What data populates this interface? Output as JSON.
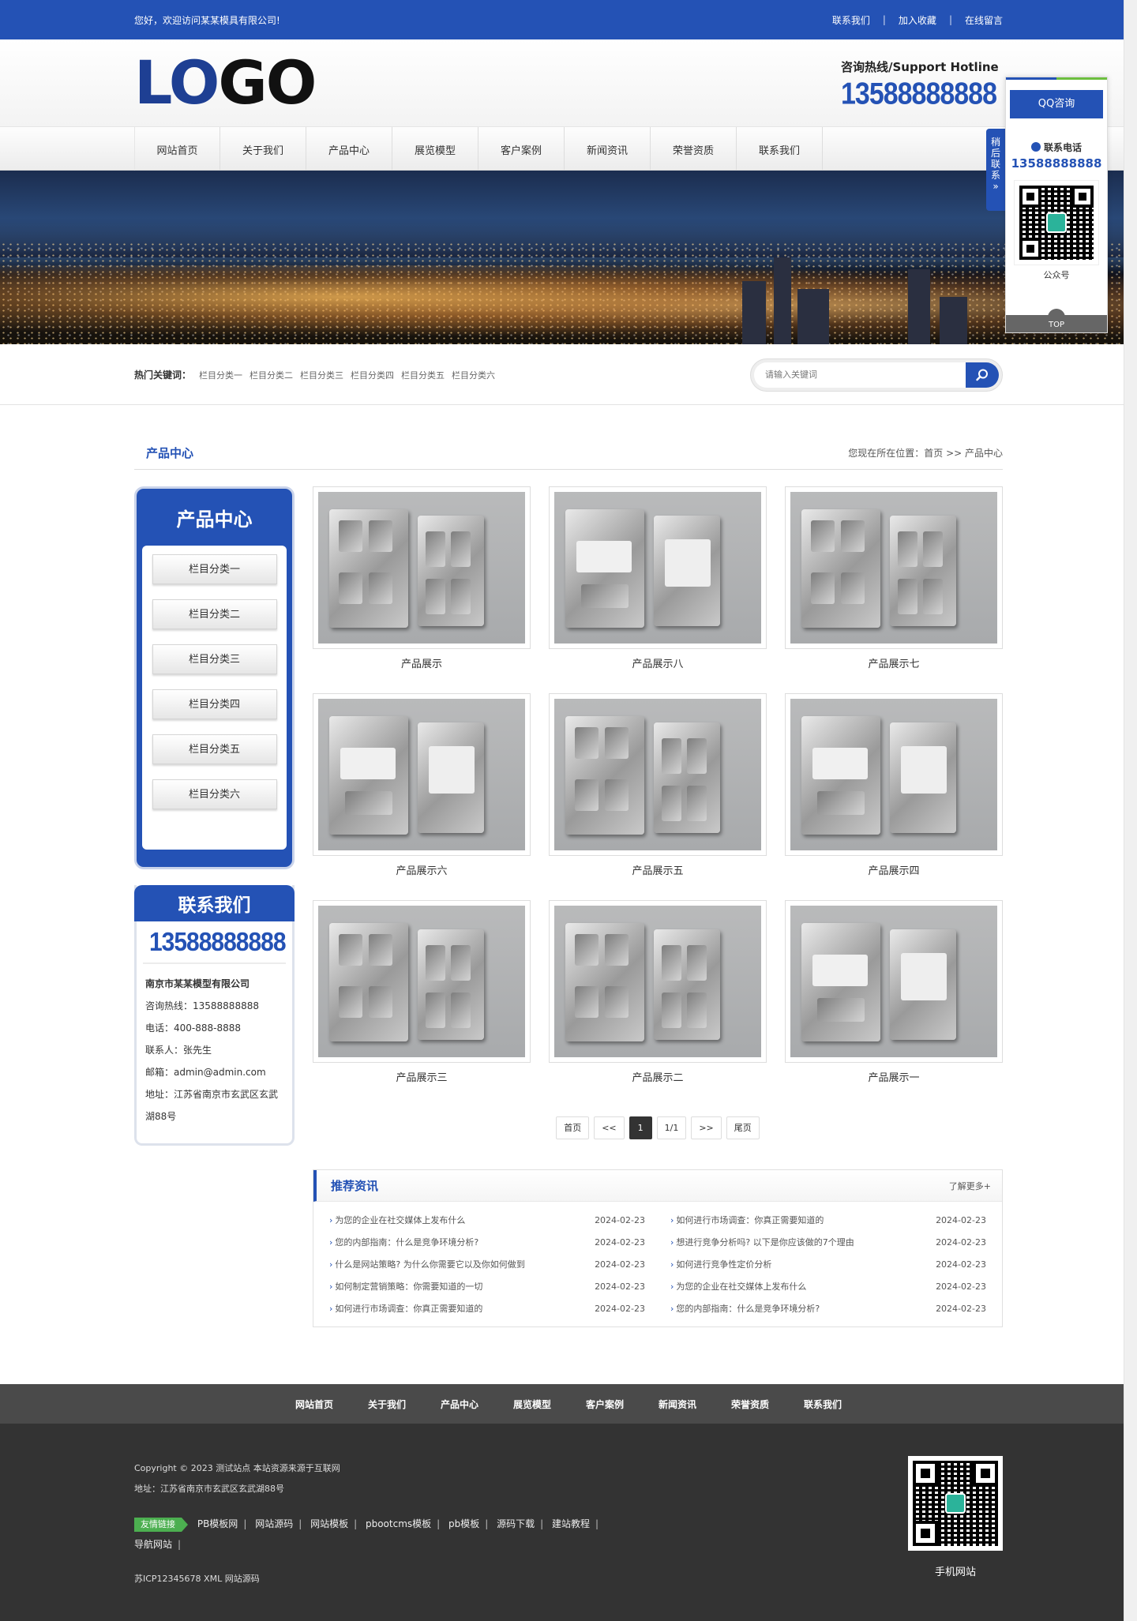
{
  "topbar": {
    "welcome": "您好，欢迎访问某某模具有限公司!",
    "links": [
      "联系我们",
      "加入收藏",
      "在线留言"
    ]
  },
  "header": {
    "logo_part1": "LO",
    "logo_part2": "GO",
    "hotline_title": "咨询热线/Support Hotline",
    "hotline_number": "13588888888"
  },
  "nav": [
    "网站首页",
    "关于我们",
    "产品中心",
    "展览模型",
    "客户案例",
    "新闻资讯",
    "荣誉资质",
    "联系我们"
  ],
  "search": {
    "hot_label": "热门关键词：",
    "keywords": [
      "栏目分类一",
      "栏目分类二",
      "栏目分类三",
      "栏目分类四",
      "栏目分类五",
      "栏目分类六"
    ],
    "placeholder": "请输入关键词"
  },
  "page": {
    "title": "产品中心",
    "breadcrumb": "您现在所在位置：首页 >> 产品中心"
  },
  "sidebar": {
    "cat_title": "产品中心",
    "categories": [
      "栏目分类一",
      "栏目分类二",
      "栏目分类三",
      "栏目分类四",
      "栏目分类五",
      "栏目分类六"
    ],
    "contact_title": "联系我们",
    "contact_number": "13588888888",
    "company": "南京市某某模型有限公司",
    "hotline": "咨询热线：13588888888",
    "phone": "电话：400-888-8888",
    "person": "联系人：张先生",
    "email": "邮箱：admin@admin.com",
    "address": "地址：江苏省南京市玄武区玄武湖88号"
  },
  "products": [
    "产品展示",
    "产品展示八",
    "产品展示七",
    "产品展示六",
    "产品展示五",
    "产品展示四",
    "产品展示三",
    "产品展示二",
    "产品展示一"
  ],
  "pager": [
    "首页",
    "<<",
    "1",
    "1/1",
    ">>",
    "尾页"
  ],
  "news": {
    "title": "推荐资讯",
    "more": "了解更多+",
    "left": [
      {
        "t": "为您的企业在社交媒体上发布什么",
        "d": "2024-02-23"
      },
      {
        "t": "您的内部指南：什么是竞争环境分析?",
        "d": "2024-02-23"
      },
      {
        "t": "什么是网站策略? 为什么你需要它以及你如何做到",
        "d": "2024-02-23"
      },
      {
        "t": "如何制定营销策略：你需要知道的一切",
        "d": "2024-02-23"
      },
      {
        "t": "如何进行市场调查：你真正需要知道的",
        "d": "2024-02-23"
      }
    ],
    "right": [
      {
        "t": "如何进行市场调查：你真正需要知道的",
        "d": "2024-02-23"
      },
      {
        "t": "想进行竞争分析吗? 以下是你应该做的7个理由",
        "d": "2024-02-23"
      },
      {
        "t": "如何进行竞争性定价分析",
        "d": "2024-02-23"
      },
      {
        "t": "为您的企业在社交媒体上发布什么",
        "d": "2024-02-23"
      },
      {
        "t": "您的内部指南：什么是竞争环境分析?",
        "d": "2024-02-23"
      }
    ]
  },
  "footer": {
    "nav": [
      "网站首页",
      "关于我们",
      "产品中心",
      "展览模型",
      "客户案例",
      "新闻资讯",
      "荣誉资质",
      "联系我们"
    ],
    "copyright": "Copyright © 2023 测试站点 本站资源来源于互联网",
    "address": "地址：江苏省南京市玄武区玄武湖88号",
    "links_label": "友情链接",
    "links": [
      "PB模板网",
      "网站源码",
      "网站模板",
      "pbootcms模板",
      "pb模板",
      "源码下载",
      "建站教程",
      "导航网站"
    ],
    "icp": "苏ICP12345678 XML 网站源码",
    "qr_caption": "手机网站"
  },
  "float": {
    "qq": "QQ咨询",
    "tel_label": "联系电话",
    "tel": "13588888888",
    "qr_caption": "公众号",
    "top": "TOP",
    "tab": "稍后联系"
  },
  "colors": {
    "brand": "#2452b5",
    "green": "#4caf50"
  }
}
